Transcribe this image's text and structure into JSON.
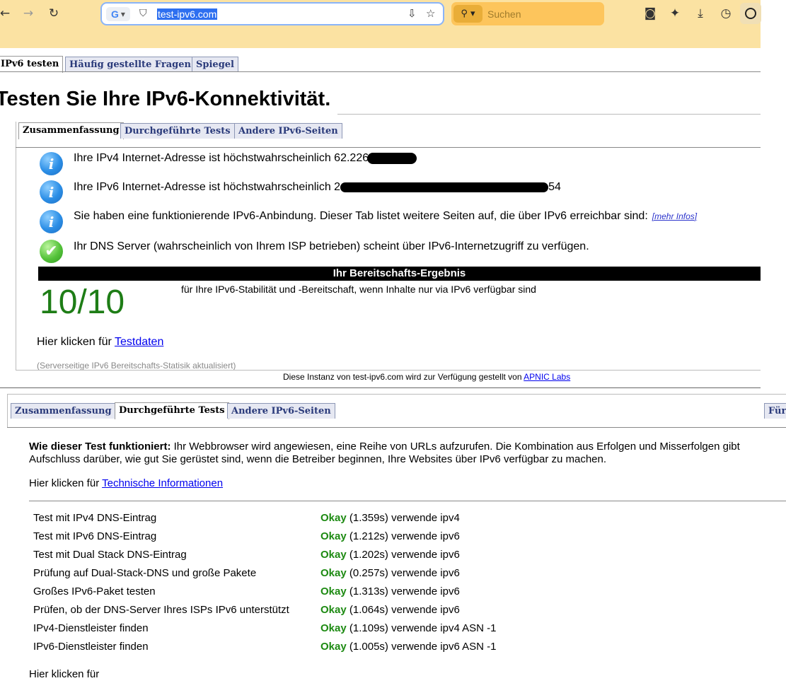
{
  "browser": {
    "url": "test-ipv6.com",
    "search_placeholder": "Suchen"
  },
  "site_tabs": [
    "IPv6 testen",
    "Häufig gestellte Fragen",
    "Spiegel"
  ],
  "page_title": "Testen Sie Ihre IPv6-Konnektivität.",
  "section_tabs": [
    "Zusammenfassung",
    "Durchgeführte Tests",
    "Andere IPv6-Seiten"
  ],
  "summary": {
    "ipv4_text": "Ihre IPv4 Internet-Adresse ist höchstwahrscheinlich 62.226",
    "ipv6_text": "Ihre IPv6 Internet-Adresse ist höchstwahrscheinlich 2",
    "ipv6_suffix": "54",
    "connectivity_text": "Sie haben eine funktionierende IPv6-Anbindung. Dieser Tab listet weitere Seiten auf, die über IPv6 erreichbar sind:",
    "more_info": "[mehr Infos]",
    "dns_text": "Ihr DNS Server (wahrscheinlich von Ihrem ISP betrieben) scheint über IPv6-Internetzugriff zu verfügen.",
    "readiness_header": "Ihr Bereitschafts-Ergebnis",
    "score": "10/10",
    "score_description": "für Ihre IPv6-Stabilität und -Bereitschaft, wenn Inhalte nur via IPv6 verfügbar sind",
    "click_prefix": "Hier klicken für",
    "test_data_link": "Testdaten",
    "stats_note": "(Serverseitige IPv6 Bereitschafts-Statisik aktualisiert)",
    "footer_text": "Diese Instanz von test-ipv6.com wird zur Verfügung gestellt von",
    "footer_link": "APNIC Labs"
  },
  "tests_section": {
    "tabs": [
      "Zusammenfassung",
      "Durchgeführte Tests",
      "Andere IPv6-Seiten",
      "Für"
    ],
    "how_label": "Wie dieser Test funktioniert:",
    "how_text_1": "Ihr Webbrowser wird angewiesen, eine Reihe von URLs aufzurufen. Die Kombination aus Erfolgen und Misserfolgen gibt",
    "how_text_2": "Aufschluss darüber, wie gut Sie gerüstet sind, wenn die Betreiber beginnen, Ihre Websites über IPv6 verfügbar zu machen.",
    "click_prefix": "Hier klicken für",
    "tech_link": "Technische Informationen",
    "tests": [
      {
        "name": "Test mit IPv4 DNS-Eintrag",
        "status": "Okay",
        "detail": "(1.359s) verwende ipv4"
      },
      {
        "name": "Test mit IPv6 DNS-Eintrag",
        "status": "Okay",
        "detail": "(1.212s) verwende ipv6"
      },
      {
        "name": "Test mit Dual Stack DNS-Eintrag",
        "status": "Okay",
        "detail": "(1.202s) verwende ipv6"
      },
      {
        "name": "Prüfung auf Dual-Stack-DNS und große Pakete",
        "status": "Okay",
        "detail": "(0.257s) verwende ipv6"
      },
      {
        "name": "Großes IPv6-Paket testen",
        "status": "Okay",
        "detail": "(1.313s) verwende ipv6"
      },
      {
        "name": "Prüfen, ob der DNS-Server Ihres ISPs IPv6 unterstützt",
        "status": "Okay",
        "detail": "(1.064s) verwende ipv6"
      },
      {
        "name": "IPv4-Dienstleister finden",
        "status": "Okay",
        "detail": "(1.109s) verwende ipv4 ASN -1"
      },
      {
        "name": "IPv6-Dienstleister finden",
        "status": "Okay",
        "detail": "(1.005s) verwende ipv6 ASN -1"
      }
    ],
    "bottom_click_prefix": "Hier klicken für"
  },
  "colors": {
    "toolbar_bg": "#fbe2a2",
    "okay_green": "#1d8a12",
    "score_green": "#1e7d16"
  }
}
